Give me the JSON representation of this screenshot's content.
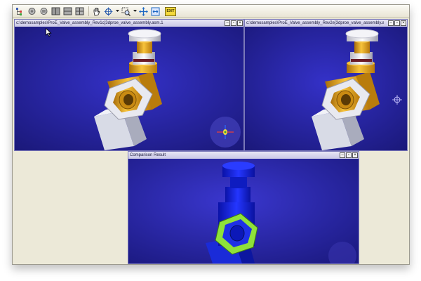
{
  "toolbar": {
    "tools": [
      {
        "name": "tree-icon"
      },
      {
        "name": "open-model-icon"
      },
      {
        "name": "save-model-icon"
      },
      {
        "name": "view-layout-1-icon"
      },
      {
        "name": "view-layout-2-icon"
      },
      {
        "name": "view-layout-3-icon"
      },
      {
        "name": "pan-hand-icon"
      },
      {
        "name": "rotate-icon"
      },
      {
        "name": "zoom-window-icon"
      },
      {
        "name": "zoom-pan-icon"
      },
      {
        "name": "fit-all-icon"
      },
      {
        "name": "exit-icon"
      }
    ],
    "exit_label": "EXIT"
  },
  "viewports": {
    "left": {
      "title": "c:\\demosamples\\ProE_Valve_assembly_Rev1c[3dproe_valve_assembly.asm.1"
    },
    "right": {
      "title": "c:\\demosamples\\ProE_Valve_assembly_Rev2e[3dproe_valve_assembly.asm.1"
    },
    "result": {
      "title": "Comparison Result"
    }
  },
  "window_controls": {
    "minimize": "–",
    "restore": "▫",
    "close": "×"
  },
  "colors": {
    "viewport_bg": "#2e2bb8",
    "part_gold": "#f0a81a",
    "part_white": "#eeeef2",
    "result_blue": "#1020e0",
    "diff_green": "#8fe23a"
  }
}
